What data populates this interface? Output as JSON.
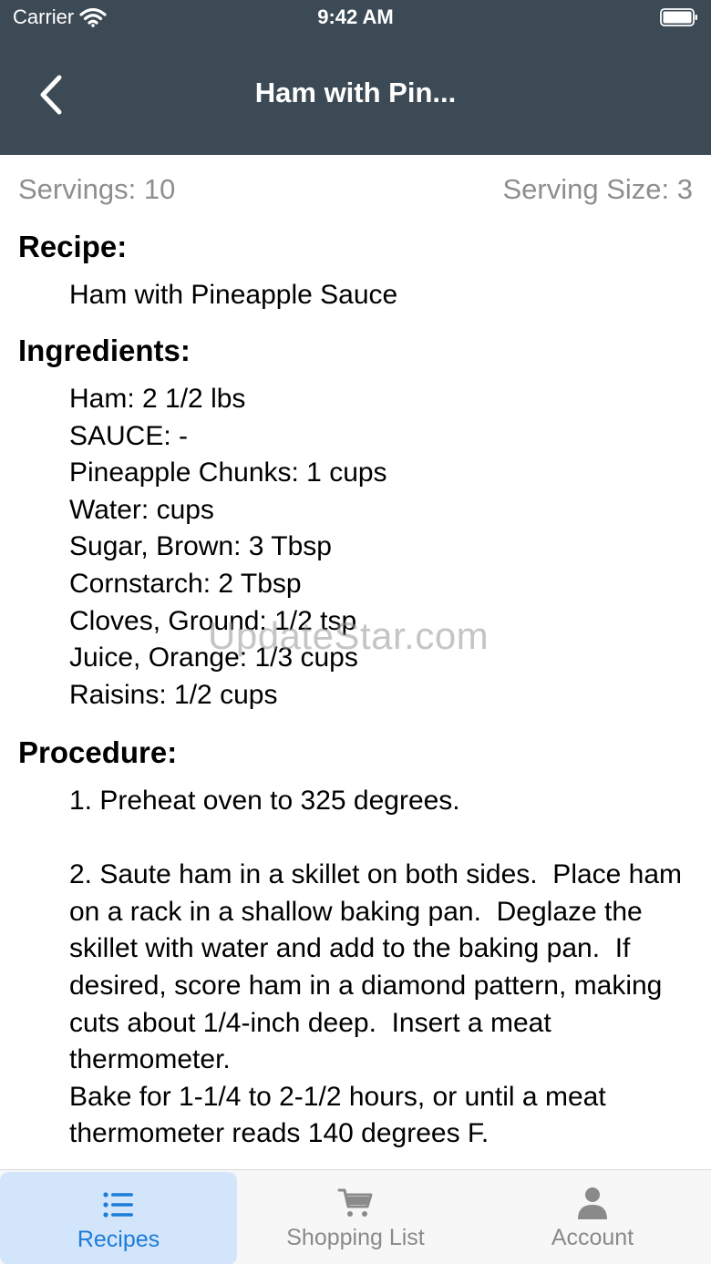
{
  "status_bar": {
    "carrier": "Carrier",
    "time": "9:42 AM"
  },
  "nav": {
    "title": "Ham with Pin..."
  },
  "servings": {
    "servings_text": "Servings: 10",
    "serving_size_text": "Serving Size: 3"
  },
  "recipe": {
    "heading": "Recipe:",
    "name": "Ham with Pineapple Sauce"
  },
  "ingredients": {
    "heading": "Ingredients:",
    "items": [
      "Ham: 2 1/2 lbs",
      "SAUCE: -",
      "Pineapple Chunks: 1 cups",
      "Water: cups",
      "Sugar, Brown: 3 Tbsp",
      "Cornstarch: 2 Tbsp",
      "Cloves, Ground: 1/2 tsp",
      "Juice, Orange: 1/3 cups",
      "Raisins: 1/2 cups"
    ]
  },
  "procedure": {
    "heading": "Procedure:",
    "text": "1. Preheat oven to 325 degrees.\n\n2. Saute ham in a skillet on both sides.  Place ham on a rack in a shallow baking pan.  Deglaze the skillet with water and add to the baking pan.  If desired, score ham in a diamond pattern, making cuts about 1/4-inch deep.  Insert a meat thermometer.\nBake for 1-1/4 to 2-1/2 hours, or until a meat thermometer reads 140 degrees F."
  },
  "watermark": "UpdateStar.com",
  "tabs": [
    {
      "label": "Recipes",
      "icon": "list-icon",
      "active": true
    },
    {
      "label": "Shopping List",
      "icon": "cart-icon",
      "active": false
    },
    {
      "label": "Account",
      "icon": "person-icon",
      "active": false
    }
  ],
  "colors": {
    "header_bg": "#3c4a55",
    "tab_active_bg": "#d3e5fb",
    "tab_active_text": "#1b7cd8",
    "tab_inactive": "#8a8a8a",
    "secondary_text": "#8e8e8e"
  }
}
